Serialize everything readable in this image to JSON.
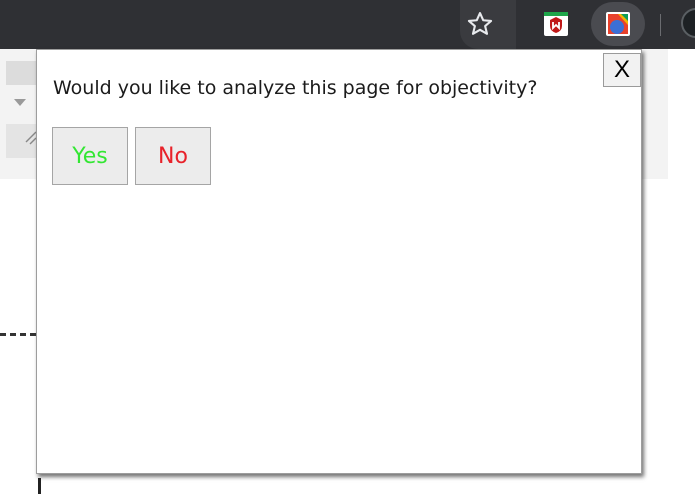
{
  "popup": {
    "question": "Would you like to analyze this page for objectivity?",
    "close_label": "X",
    "yes_label": "Yes",
    "no_label": "No"
  },
  "colors": {
    "yes_text": "#33e633",
    "no_text": "#e8222a",
    "toolbar_bg": "#2f3034"
  },
  "toolbar": {
    "icons": [
      "bookmark-star-icon",
      "mcafee-extension-icon",
      "objectivity-extension-icon",
      "profile-avatar-icon"
    ]
  }
}
